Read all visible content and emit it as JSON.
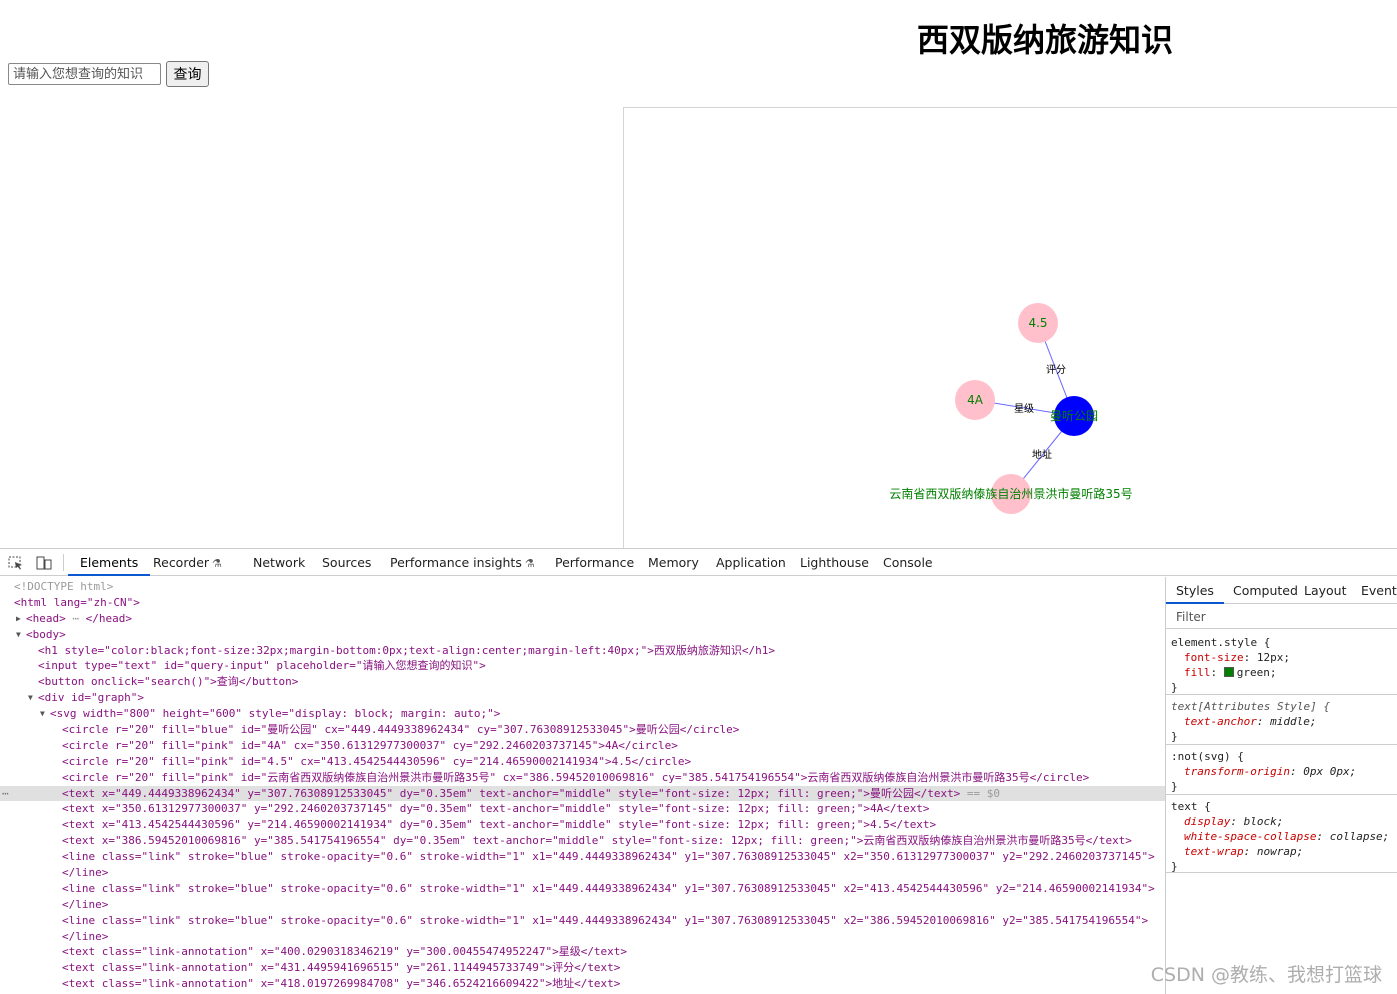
{
  "page": {
    "title": "西双版纳旅游知识",
    "search_placeholder": "请输入您想查询的知识",
    "search_button": "查询"
  },
  "graph": {
    "nodes": [
      {
        "id": "center",
        "label": "曼听公园",
        "fill": "#0000ff",
        "label_color": "#008000"
      },
      {
        "id": "rating",
        "label": "4.5",
        "fill": "#ffc0cb",
        "label_color": "#008000"
      },
      {
        "id": "grade",
        "label": "4A",
        "fill": "#ffc0cb",
        "label_color": "#008000"
      },
      {
        "id": "address",
        "label": "云南省西双版纳傣族自治州景洪市曼听路35号",
        "fill": "#ffc0cb",
        "label_color": "#008000"
      }
    ],
    "links": [
      {
        "source": "center",
        "target": "rating",
        "label": "评分"
      },
      {
        "source": "center",
        "target": "grade",
        "label": "星级"
      },
      {
        "source": "center",
        "target": "address",
        "label": "地址"
      }
    ],
    "link_color": "#0000ff"
  },
  "devtools": {
    "tabs": [
      "Elements",
      "Recorder",
      "Network",
      "Sources",
      "Performance insights",
      "Performance",
      "Memory",
      "Application",
      "Lighthouse",
      "Console"
    ],
    "active_tab": "Elements",
    "styles_tabs": [
      "Styles",
      "Computed",
      "Layout",
      "Event L"
    ],
    "filter_placeholder": "Filter",
    "code": {
      "doctype": "<!DOCTYPE html>",
      "html_open": "<html lang=\"zh-CN\">",
      "head": "<head>",
      "head_close": "</head>",
      "body": "<body>",
      "h1": "<h1 style=\"color:black;font-size:32px;margin-bottom:0px;text-align:center;margin-left:40px;\">西双版纳旅游知识</h1>",
      "input": "<input type=\"text\" id=\"query-input\" placeholder=\"请输入您想查询的知识\">",
      "button": "<button onclick=\"search()\">查询</button>",
      "div": "<div id=\"graph\">",
      "svg": "<svg width=\"800\" height=\"600\" style=\"display: block; margin: auto;\">",
      "c1": "<circle r=\"20\" fill=\"blue\" id=\"曼听公园\" cx=\"449.4449338962434\" cy=\"307.76308912533045\">曼听公园</circle>",
      "c2": "<circle r=\"20\" fill=\"pink\" id=\"4A\" cx=\"350.61312977300037\" cy=\"292.2460203737145\">4A</circle>",
      "c3": "<circle r=\"20\" fill=\"pink\" id=\"4.5\" cx=\"413.4542544430596\" cy=\"214.46590002141934\">4.5</circle>",
      "c4": "<circle r=\"20\" fill=\"pink\" id=\"云南省西双版纳傣族自治州景洪市曼听路35号\" cx=\"386.59452010069816\" cy=\"385.541754196554\">云南省西双版纳傣族自治州景洪市曼听路35号</circle>",
      "t1": "<text x=\"449.4449338962434\" y=\"307.76308912533045\" dy=\"0.35em\" text-anchor=\"middle\" style=\"font-size: 12px; fill: green;\">曼听公园</text>",
      "t1_suffix": " == $0",
      "t2": "<text x=\"350.61312977300037\" y=\"292.2460203737145\" dy=\"0.35em\" text-anchor=\"middle\" style=\"font-size: 12px; fill: green;\">4A</text>",
      "t3": "<text x=\"413.4542544430596\" y=\"214.46590002141934\" dy=\"0.35em\" text-anchor=\"middle\" style=\"font-size: 12px; fill: green;\">4.5</text>",
      "t4": "<text x=\"386.59452010069816\" y=\"385.541754196554\" dy=\"0.35em\" text-anchor=\"middle\" style=\"font-size: 12px; fill: green;\">云南省西双版纳傣族自治州景洪市曼听路35号</text>",
      "l1": "<line class=\"link\" stroke=\"blue\" stroke-opacity=\"0.6\" stroke-width=\"1\" x1=\"449.4449338962434\" y1=\"307.76308912533045\" x2=\"350.61312977300037\" y2=\"292.2460203737145\">",
      "l2": "<line class=\"link\" stroke=\"blue\" stroke-opacity=\"0.6\" stroke-width=\"1\" x1=\"449.4449338962434\" y1=\"307.76308912533045\" x2=\"413.4542544430596\" y2=\"214.46590002141934\">",
      "l3": "<line class=\"link\" stroke=\"blue\" stroke-opacity=\"0.6\" stroke-width=\"1\" x1=\"449.4449338962434\" y1=\"307.76308912533045\" x2=\"386.59452010069816\" y2=\"385.541754196554\">",
      "line_close": "</line>",
      "a1": "<text class=\"link-annotation\" x=\"400.0290318346219\" y=\"300.00455474952247\">星级</text>",
      "a2": "<text class=\"link-annotation\" x=\"431.4495941696515\" y=\"261.1144945733749\">评分</text>",
      "a3": "<text class=\"link-annotation\" x=\"418.0197269984708\" y=\"346.6524216609422\">地址</text>"
    },
    "styles": {
      "r1_selector": "element.style {",
      "r1_p1_name": "font-size",
      "r1_p1_val": "12px;",
      "r1_p2_name": "fill",
      "r1_p2_val": "green;",
      "r2_selector": "text[Attributes Style] {",
      "r2_p1_name": "text-anchor",
      "r2_p1_val": "middle;",
      "r3_selector": ":not(svg) {",
      "r3_p1_name": "transform-origin",
      "r3_p1_val": "0px 0px;",
      "r4_selector": "text {",
      "r4_p1_name": "display",
      "r4_p1_val": "block;",
      "r4_p2_name": "white-space-collapse",
      "r4_p2_val": "collapse;",
      "r4_p3_name": "text-wrap",
      "r4_p3_val": "nowrap;",
      "close": "}"
    }
  },
  "watermark": "CSDN @教练、我想打篮球"
}
